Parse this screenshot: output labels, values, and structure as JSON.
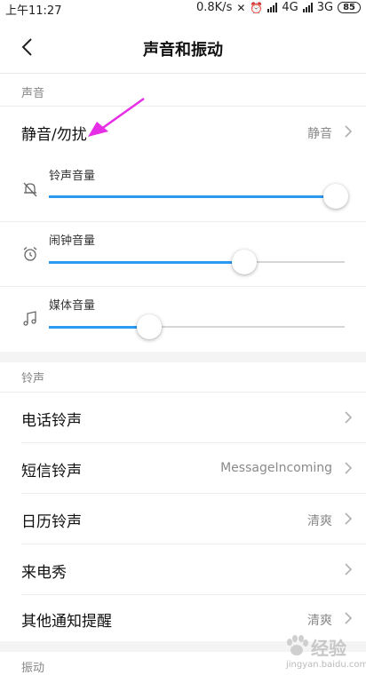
{
  "status_bar": {
    "time": "上午11:27",
    "net_speed": "0.8K/s",
    "sim1_label": "4G",
    "sim2_label": "3G",
    "battery": "85"
  },
  "header": {
    "title": "声音和振动"
  },
  "sections": {
    "sound": "声音",
    "ringtone": "铃声",
    "vibration": "振动"
  },
  "silent_row": {
    "label": "静音/勿扰",
    "value": "静音"
  },
  "volumes": [
    {
      "label": "铃声音量",
      "icon": "muted-bell-icon",
      "level": 0.97
    },
    {
      "label": "闹钟音量",
      "icon": "alarm-clock-icon",
      "level": 0.66
    },
    {
      "label": "媒体音量",
      "icon": "music-note-icon",
      "level": 0.34
    }
  ],
  "ring_rows": [
    {
      "label": "电话铃声",
      "value": ""
    },
    {
      "label": "短信铃声",
      "value": "MessageIncoming"
    },
    {
      "label": "日历铃声",
      "value": "清爽"
    },
    {
      "label": "来电秀",
      "value": ""
    },
    {
      "label": "其他通知提醒",
      "value": "清爽"
    }
  ],
  "watermark": {
    "main": "经验",
    "sub": "jingyan.baidu.com"
  },
  "colors": {
    "accent": "#2b9af3",
    "annotation_arrow": "#e62ee6"
  }
}
